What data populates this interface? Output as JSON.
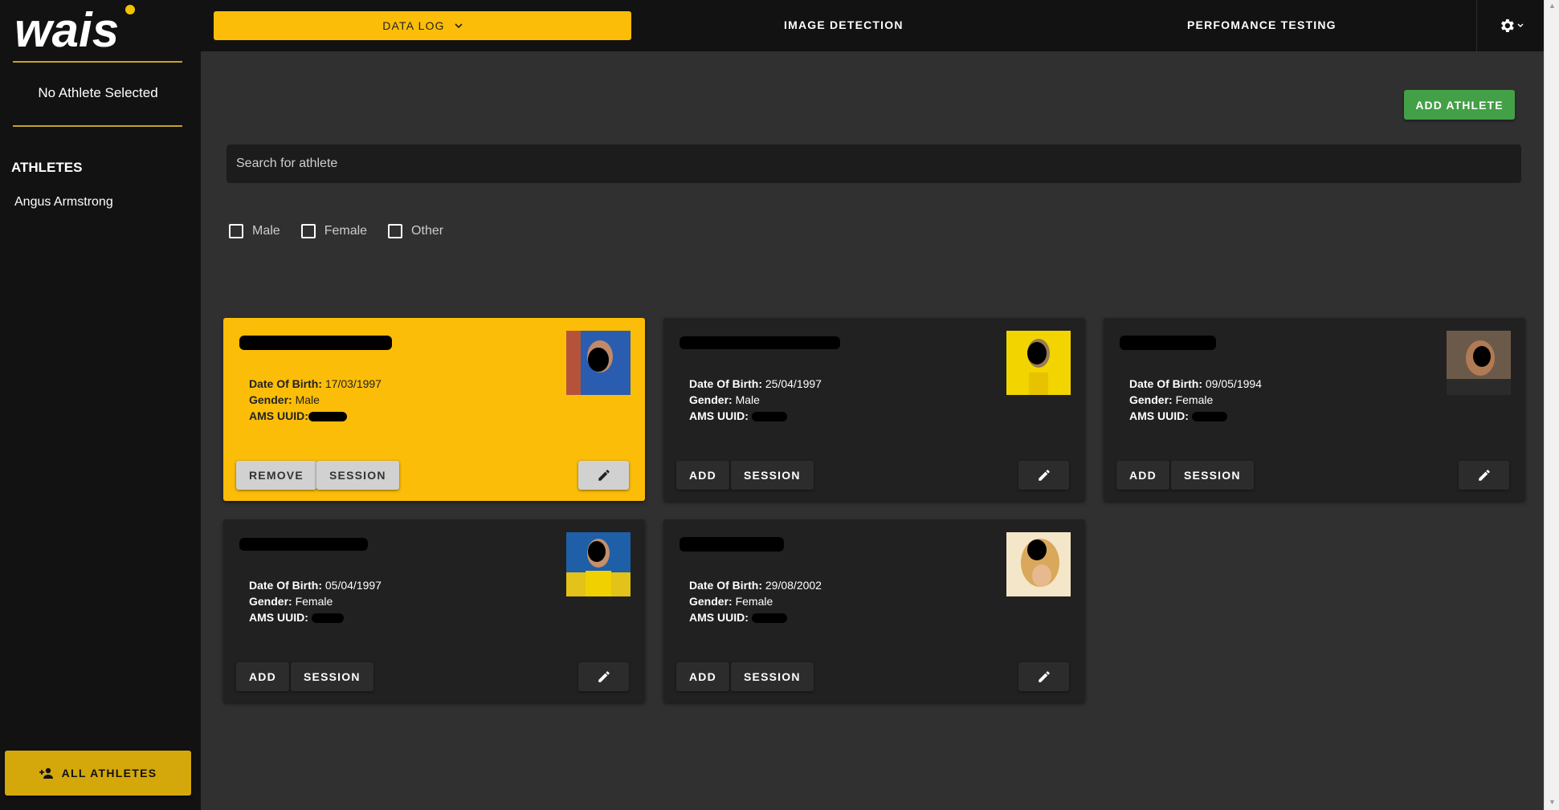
{
  "sidebar": {
    "logo_text": "wais",
    "selected_label": "No Athlete Selected",
    "athletes_heading": "ATHLETES",
    "athletes": [
      "Angus Armstrong"
    ],
    "all_athletes_label": "ALL ATHLETES"
  },
  "nav": {
    "data_log": "DATA LOG",
    "image_detection": "IMAGE DETECTION",
    "performance_testing": "PERFOMANCE TESTING"
  },
  "main": {
    "add_athlete_label": "ADD ATHLETE",
    "search_placeholder": "Search for athlete",
    "filters": [
      "Male",
      "Female",
      "Other"
    ]
  },
  "labels": {
    "dob": "Date Of Birth:",
    "gender": "Gender:",
    "uuid": "AMS UUID:",
    "session": "SESSION",
    "add": "ADD",
    "remove": "REMOVE"
  },
  "cards": [
    {
      "dob": "17/03/1997",
      "gender": "Male",
      "action": "REMOVE",
      "selected": true,
      "photo_bg": "#2a5db0"
    },
    {
      "dob": "25/04/1997",
      "gender": "Male",
      "action": "ADD",
      "selected": false,
      "photo_bg": "#f2d500"
    },
    {
      "dob": "09/05/1994",
      "gender": "Female",
      "action": "ADD",
      "selected": false,
      "photo_bg": "#6b5a4a"
    },
    {
      "dob": "05/04/1997",
      "gender": "Female",
      "action": "ADD",
      "selected": false,
      "photo_bg": "#1e7a3a"
    },
    {
      "dob": "29/08/2002",
      "gender": "Female",
      "action": "ADD",
      "selected": false,
      "photo_bg": "#e9c36b"
    }
  ],
  "colors": {
    "accent": "#fbbd08",
    "success": "#43a047",
    "background": "#303030",
    "surface": "#212121"
  }
}
